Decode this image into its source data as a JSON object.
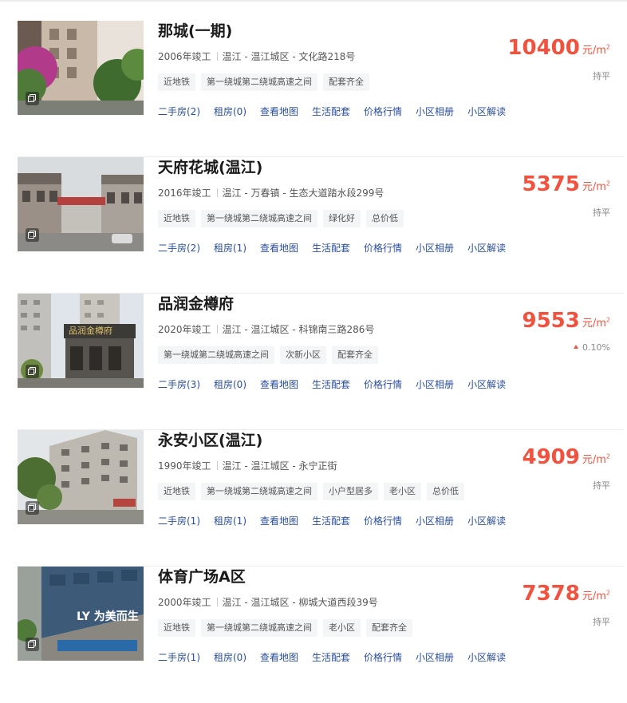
{
  "unit": "元/m",
  "unit_sup": "2",
  "colors": {
    "price": "#f0523d",
    "link": "#2a4ea0",
    "tag_bg": "#f4f5f7"
  },
  "listings": [
    {
      "name": "那城(一期)",
      "year": "2006年竣工",
      "location": "温江 - 温江城区 - 文化路218号",
      "tags": [
        "近地铁",
        "第一绕城第二绕城高速之间",
        "配套齐全"
      ],
      "price": "10400",
      "change": "持平",
      "links": [
        "二手房(2)",
        "租房(0)",
        "查看地图",
        "生活配套",
        "价格行情",
        "小区相册",
        "小区解读"
      ]
    },
    {
      "name": "天府花城(温江)",
      "year": "2016年竣工",
      "location": "温江 - 万春镇 - 生态大道踏水段299号",
      "tags": [
        "近地铁",
        "第一绕城第二绕城高速之间",
        "绿化好",
        "总价低"
      ],
      "price": "5375",
      "change": "持平",
      "links": [
        "二手房(2)",
        "租房(1)",
        "查看地图",
        "生活配套",
        "价格行情",
        "小区相册",
        "小区解读"
      ]
    },
    {
      "name": "品润金樽府",
      "year": "2020年竣工",
      "location": "温江 - 温江城区 - 科锦南三路286号",
      "tags": [
        "第一绕城第二绕城高速之间",
        "次新小区",
        "配套齐全"
      ],
      "price": "9553",
      "change": "0.10%",
      "links": [
        "二手房(3)",
        "租房(0)",
        "查看地图",
        "生活配套",
        "价格行情",
        "小区相册",
        "小区解读"
      ]
    },
    {
      "name": "永安小区(温江)",
      "year": "1990年竣工",
      "location": "温江 - 温江城区 - 永宁正街",
      "tags": [
        "近地铁",
        "第一绕城第二绕城高速之间",
        "小户型居多",
        "老小区",
        "总价低"
      ],
      "price": "4909",
      "change": "持平",
      "links": [
        "二手房(1)",
        "租房(1)",
        "查看地图",
        "生活配套",
        "价格行情",
        "小区相册",
        "小区解读"
      ]
    },
    {
      "name": "体育广场A区",
      "year": "2000年竣工",
      "location": "温江 - 温江城区 - 柳城大道西段39号",
      "tags": [
        "近地铁",
        "第一绕城第二绕城高速之间",
        "老小区",
        "配套齐全"
      ],
      "price": "7378",
      "change": "持平",
      "links": [
        "二手房(1)",
        "租房(0)",
        "查看地图",
        "生活配套",
        "价格行情",
        "小区相册",
        "小区解读"
      ]
    }
  ],
  "photo_signs": [
    "品润金樽府",
    "LY 为美而生"
  ]
}
